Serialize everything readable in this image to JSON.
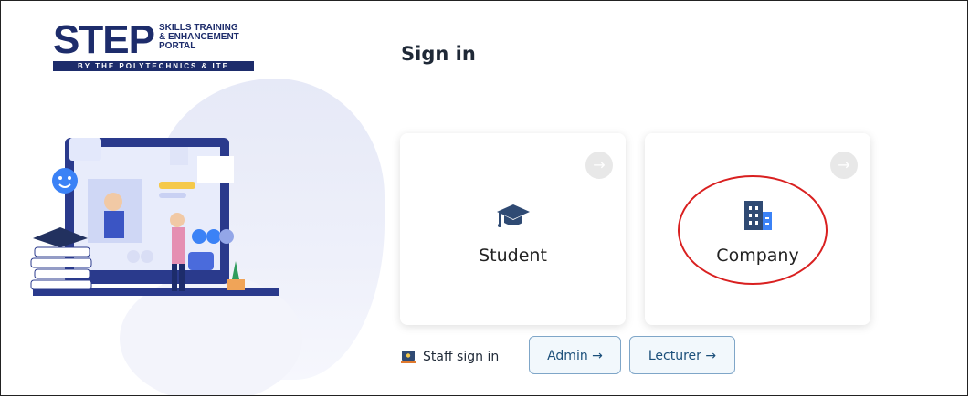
{
  "logo": {
    "big_text": "STEP",
    "small_lines": [
      "SKILLS TRAINING",
      "& ENHANCEMENT",
      "PORTAL"
    ],
    "tagline": "BY THE POLYTECHNICS & ITE"
  },
  "signin": {
    "title": "Sign in",
    "student_label": "Student",
    "company_label": "Company",
    "arrow_glyph": "→"
  },
  "staff": {
    "label": "Staff sign in",
    "admin_label": "Admin →",
    "lecturer_label": "Lecturer →"
  },
  "colors": {
    "brand_navy": "#1d2c6b",
    "button_border": "#7fa6c8",
    "annotation_red": "#d92020",
    "icon_blue": "#2f4a73"
  },
  "icons": [
    "graduation-cap-icon",
    "building-icon",
    "arrow-right-icon",
    "staff-laptop-icon"
  ]
}
